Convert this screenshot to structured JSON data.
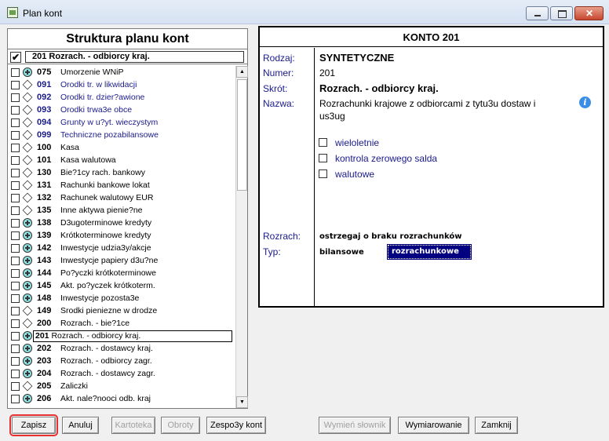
{
  "window": {
    "title": "Plan kont"
  },
  "left": {
    "header": "Struktura planu kont",
    "selected_check": "✔",
    "selected_field": "201   Rozrach. - odbiorcy kraj.",
    "rows": [
      {
        "num": "075",
        "name": "Umorzenie WNiP",
        "icon": "plus",
        "blue": false
      },
      {
        "num": "091",
        "name": "Orodki tr. w likwidacji",
        "icon": "diamond",
        "blue": true
      },
      {
        "num": "092",
        "name": "Orodki tr. dzier?awione",
        "icon": "diamond",
        "blue": true
      },
      {
        "num": "093",
        "name": "Orodki trwa3e obce",
        "icon": "diamond",
        "blue": true
      },
      {
        "num": "094",
        "name": "Grunty w u?yt. wieczystym",
        "icon": "diamond",
        "blue": true
      },
      {
        "num": "099",
        "name": "Techniczne pozabilansowe",
        "icon": "diamond",
        "blue": true
      },
      {
        "num": "100",
        "name": "Kasa",
        "icon": "diamond",
        "blue": false
      },
      {
        "num": "101",
        "name": "Kasa walutowa",
        "icon": "diamond",
        "blue": false
      },
      {
        "num": "130",
        "name": "Bie?1cy rach. bankowy",
        "icon": "diamond",
        "blue": false
      },
      {
        "num": "131",
        "name": "Rachunki bankowe lokat",
        "icon": "diamond",
        "blue": false
      },
      {
        "num": "132",
        "name": "Rachunek walutowy EUR",
        "icon": "diamond",
        "blue": false
      },
      {
        "num": "135",
        "name": "Inne aktywa pienie?ne",
        "icon": "diamond",
        "blue": false
      },
      {
        "num": "138",
        "name": "D3ugoterminowe kredyty",
        "icon": "plus",
        "blue": false
      },
      {
        "num": "139",
        "name": "Krótkoterminowe kredyty",
        "icon": "plus",
        "blue": false
      },
      {
        "num": "142",
        "name": "Inwestycje udzia3y/akcje",
        "icon": "plus",
        "blue": false
      },
      {
        "num": "143",
        "name": "Inwestycje papiery d3u?ne",
        "icon": "plus",
        "blue": false
      },
      {
        "num": "144",
        "name": "Po?yczki krótkoterminowe",
        "icon": "plus",
        "blue": false
      },
      {
        "num": "145",
        "name": "Akt. po?yczek krótkoterm.",
        "icon": "plus",
        "blue": false
      },
      {
        "num": "148",
        "name": "Inwestycje pozosta3e",
        "icon": "plus",
        "blue": false
      },
      {
        "num": "149",
        "name": "Srodki pieniezne w drodze",
        "icon": "diamond",
        "blue": false
      },
      {
        "num": "200",
        "name": "Rozrach. - bie?1ce",
        "icon": "diamond",
        "blue": false
      },
      {
        "num": "201",
        "name": "Rozrach. - odbiorcy kraj.",
        "icon": "plus",
        "blue": false,
        "current": true
      },
      {
        "num": "202",
        "name": "Rozrach. - dostawcy kraj.",
        "icon": "plus",
        "blue": false
      },
      {
        "num": "203",
        "name": "Rozrach. - odbiorcy zagr.",
        "icon": "plus",
        "blue": false
      },
      {
        "num": "204",
        "name": "Rozrach. - dostawcy zagr.",
        "icon": "plus",
        "blue": false
      },
      {
        "num": "205",
        "name": "Zaliczki",
        "icon": "diamond",
        "blue": false
      },
      {
        "num": "206",
        "name": "Akt. nale?nooci odb. kraj",
        "icon": "plus",
        "blue": false
      }
    ]
  },
  "right": {
    "header": "KONTO  201",
    "labels": {
      "rodzaj": "Rodzaj:",
      "numer": "Numer:",
      "skrot": "Skrót:",
      "nazwa": "Nazwa:",
      "rozrach": "Rozrach:",
      "typ": "Typ:"
    },
    "rodzaj": "SYNTETYCZNE",
    "numer": "201",
    "skrot": "Rozrach. - odbiorcy kraj.",
    "nazwa_line1": "Rozrachunki krajowe z odbiorcami z tytu3u dostaw i",
    "nazwa_line2": "us3ug",
    "options": [
      "wieloletnie",
      "kontrola zerowego salda",
      "walutowe"
    ],
    "rozrach_value": "ostrzegaj o braku rozrachunków",
    "typ_value": "bilansowe",
    "typ_selected": "rozrachunkowe"
  },
  "buttons": {
    "zapisz": "Zapisz",
    "anuluj": "Anuluj",
    "kartoteka": "Kartoteka",
    "obroty": "Obroty",
    "zespoly": "Zespo3y kont",
    "wymien": "Wymień słownik",
    "wymiarowanie": "Wymiarowanie",
    "zamknij": "Zamknij"
  }
}
